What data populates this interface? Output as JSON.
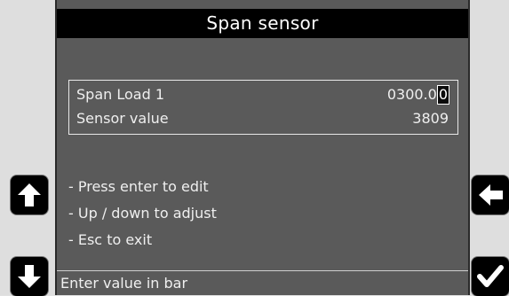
{
  "screen": {
    "title": "Span sensor"
  },
  "data_rows": [
    {
      "label": "Span Load 1",
      "value_prefix": "0300.0",
      "value_cursor": "0"
    },
    {
      "label": "Sensor value",
      "value": "3809"
    }
  ],
  "instructions": [
    "- Press enter to edit",
    "- Up / down to adjust",
    "- Esc to exit"
  ],
  "status": {
    "text": "Enter value in bar"
  },
  "buttons": {
    "up": {
      "icon": "arrow-up-icon"
    },
    "down": {
      "icon": "arrow-down-icon"
    },
    "back": {
      "icon": "arrow-left-icon"
    },
    "ok": {
      "icon": "checkmark-icon"
    }
  },
  "colors": {
    "screen_bg": "#5a5a5a",
    "title_bg": "#000000",
    "text": "#efefef",
    "panel_bg": "#dedede",
    "button_bg": "#000000"
  }
}
